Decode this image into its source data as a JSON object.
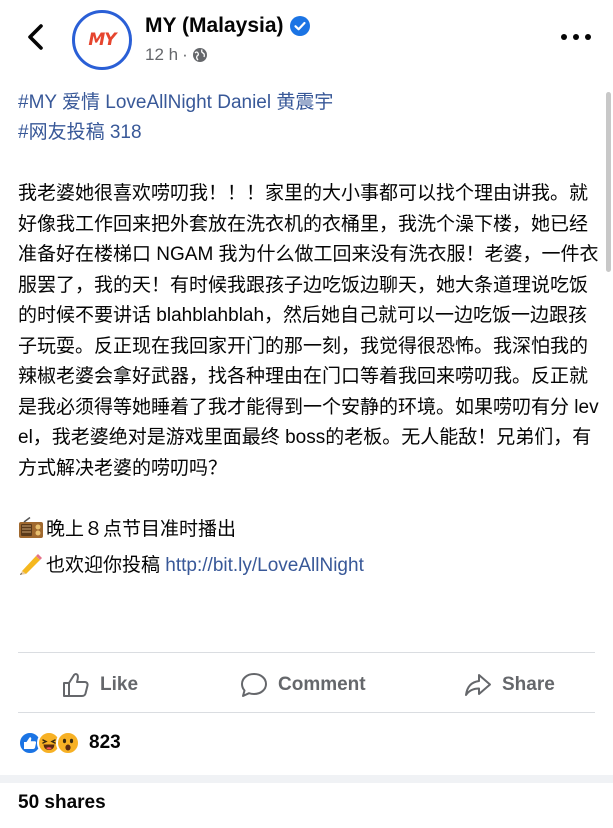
{
  "header": {
    "page_name": "MY (Malaysia)",
    "logo_text": "MY",
    "time": "12 h",
    "separator": "·",
    "audience_icon": "globe-icon",
    "back_icon": "chevron-left-icon",
    "more_icon": "more-horizontal-icon",
    "verified_icon": "verified-badge-icon"
  },
  "post": {
    "hashtag_line_1": "#MY 爱情 LoveAllNight Daniel 黄震宇",
    "hashtag_line_2": "#网友投稿 318",
    "body": "我老婆她很喜欢唠叨我！！！家里的大小事都可以找个理由讲我。就好像我工作回来把外套放在洗衣机的衣桶里，我洗个澡下楼，她已经准备好在楼梯口 NGAM 我为什么做工回来没有洗衣服！老婆，一件衣服罢了，我的天！有时候我跟孩子边吃饭边聊天，她大条道理说吃饭的时候不要讲话 blahblahblah，然后她自己就可以一边吃饭一边跟孩子玩耍。反正现在我回家开门的那一刻，我觉得很恐怖。我深怕我的辣椒老婆会拿好武器，找各种理由在门口等着我回来唠叨我。反正就是我必须得等她睡着了我才能得到一个安静的环境。如果唠叨有分 level，我老婆绝对是游戏里面最终 boss的老板。无人能敌！兄弟们，有方式解决老婆的唠叨吗？",
    "schedule_line": "晚上８点节目准时播出",
    "schedule_icon": "radio-icon",
    "submit_text": "也欢迎你投稿",
    "submit_icon": "pencil-icon",
    "submit_link": "http://bit.ly/LoveAllNight"
  },
  "actions": {
    "like_label": "Like",
    "comment_label": "Comment",
    "share_label": "Share"
  },
  "stats": {
    "reaction_icons": [
      "like-icon",
      "haha-icon",
      "wow-icon"
    ],
    "reaction_count": "823",
    "shares": "50 shares"
  },
  "colors": {
    "link": "#385898",
    "secondary_text": "#65676b",
    "verified_blue": "#1b74e4"
  }
}
